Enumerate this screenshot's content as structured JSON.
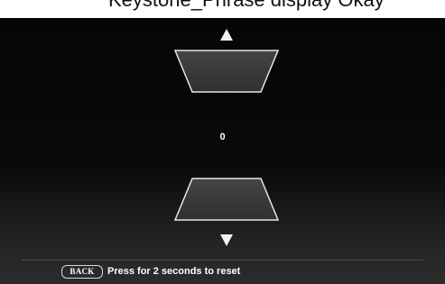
{
  "header": {
    "partial_text": "Keystone_Phrase display Okay"
  },
  "keystone": {
    "value": "0",
    "increase_icon": "arrow-up-icon",
    "decrease_icon": "arrow-down-icon"
  },
  "footer": {
    "back_key_label": "BACK",
    "hint": "Press for 2 seconds to reset"
  },
  "colors": {
    "background": "#050505",
    "shape_fill": "#3a3a3a",
    "shape_stroke": "#e6e6e6",
    "text": "#ffffff"
  }
}
